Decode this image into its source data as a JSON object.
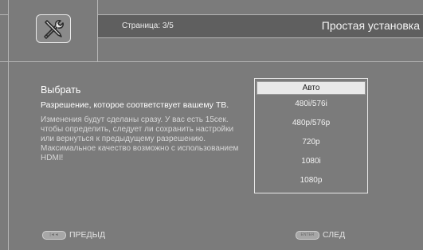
{
  "header": {
    "page_indicator": "Страница: 3/5",
    "title": "Простая установка",
    "icon": "wrench-screwdriver-icon"
  },
  "main": {
    "heading": "Выбрать",
    "description": "Разрешение, которое соответствует вашему ТВ.",
    "note": "Изменения будут сделаны сразу. У вас есть 15сек. чтобы определить, следует ли сохранить настройки или вернуться к предыдущему разрешению. Максимальное качество возможно с использованием HDMI!"
  },
  "resolution_list": {
    "selected_index": 0,
    "options": [
      "Авто",
      "480i/576i",
      "480p/576p",
      "720p",
      "1080i",
      "1080p"
    ]
  },
  "footer": {
    "prev_key": "|◄◄",
    "prev_label": "ПРЕДЫД",
    "next_key": "ENTER",
    "next_label": "СЛЕД"
  },
  "colors": {
    "background": "#7b7b7b",
    "header_bar": "#5f5f5f",
    "highlight": "#e9e9e9"
  }
}
